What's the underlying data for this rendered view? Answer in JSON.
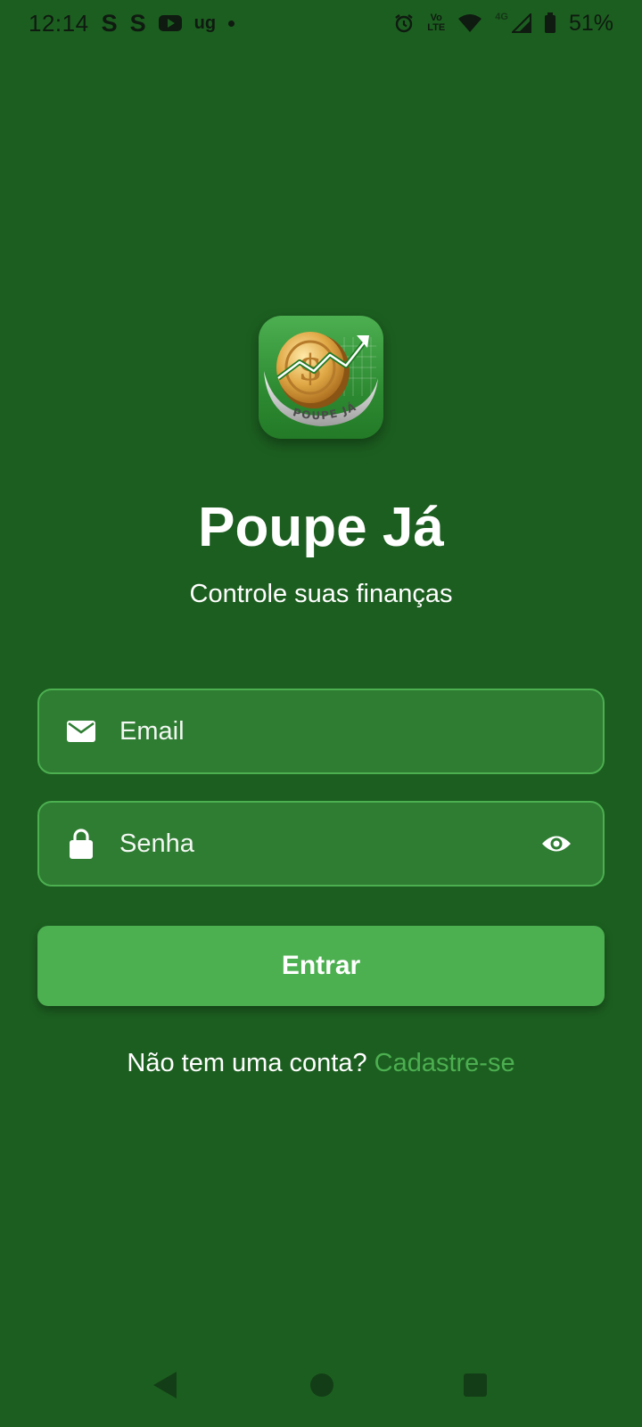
{
  "status_bar": {
    "time": "12:14",
    "left_icons": [
      "S",
      "S"
    ],
    "ug_label": "ug",
    "volte_top": "Vo",
    "volte_bottom": "LTE",
    "network": "4G",
    "battery_percent": "51%"
  },
  "logo": {
    "icon": "coin-growth-logo-icon",
    "text": "POUPE JÁ"
  },
  "app": {
    "title": "Poupe Já",
    "subtitle": "Controle suas finanças"
  },
  "form": {
    "email_placeholder": "Email",
    "email_value": "",
    "password_placeholder": "Senha",
    "password_value": "",
    "submit_label": "Entrar"
  },
  "signup": {
    "prompt": "Não tem uma conta?",
    "link_label": "Cadastre-se"
  },
  "colors": {
    "background": "#1c5e20",
    "field_background": "#2e7d32",
    "accent": "#4caf50"
  }
}
